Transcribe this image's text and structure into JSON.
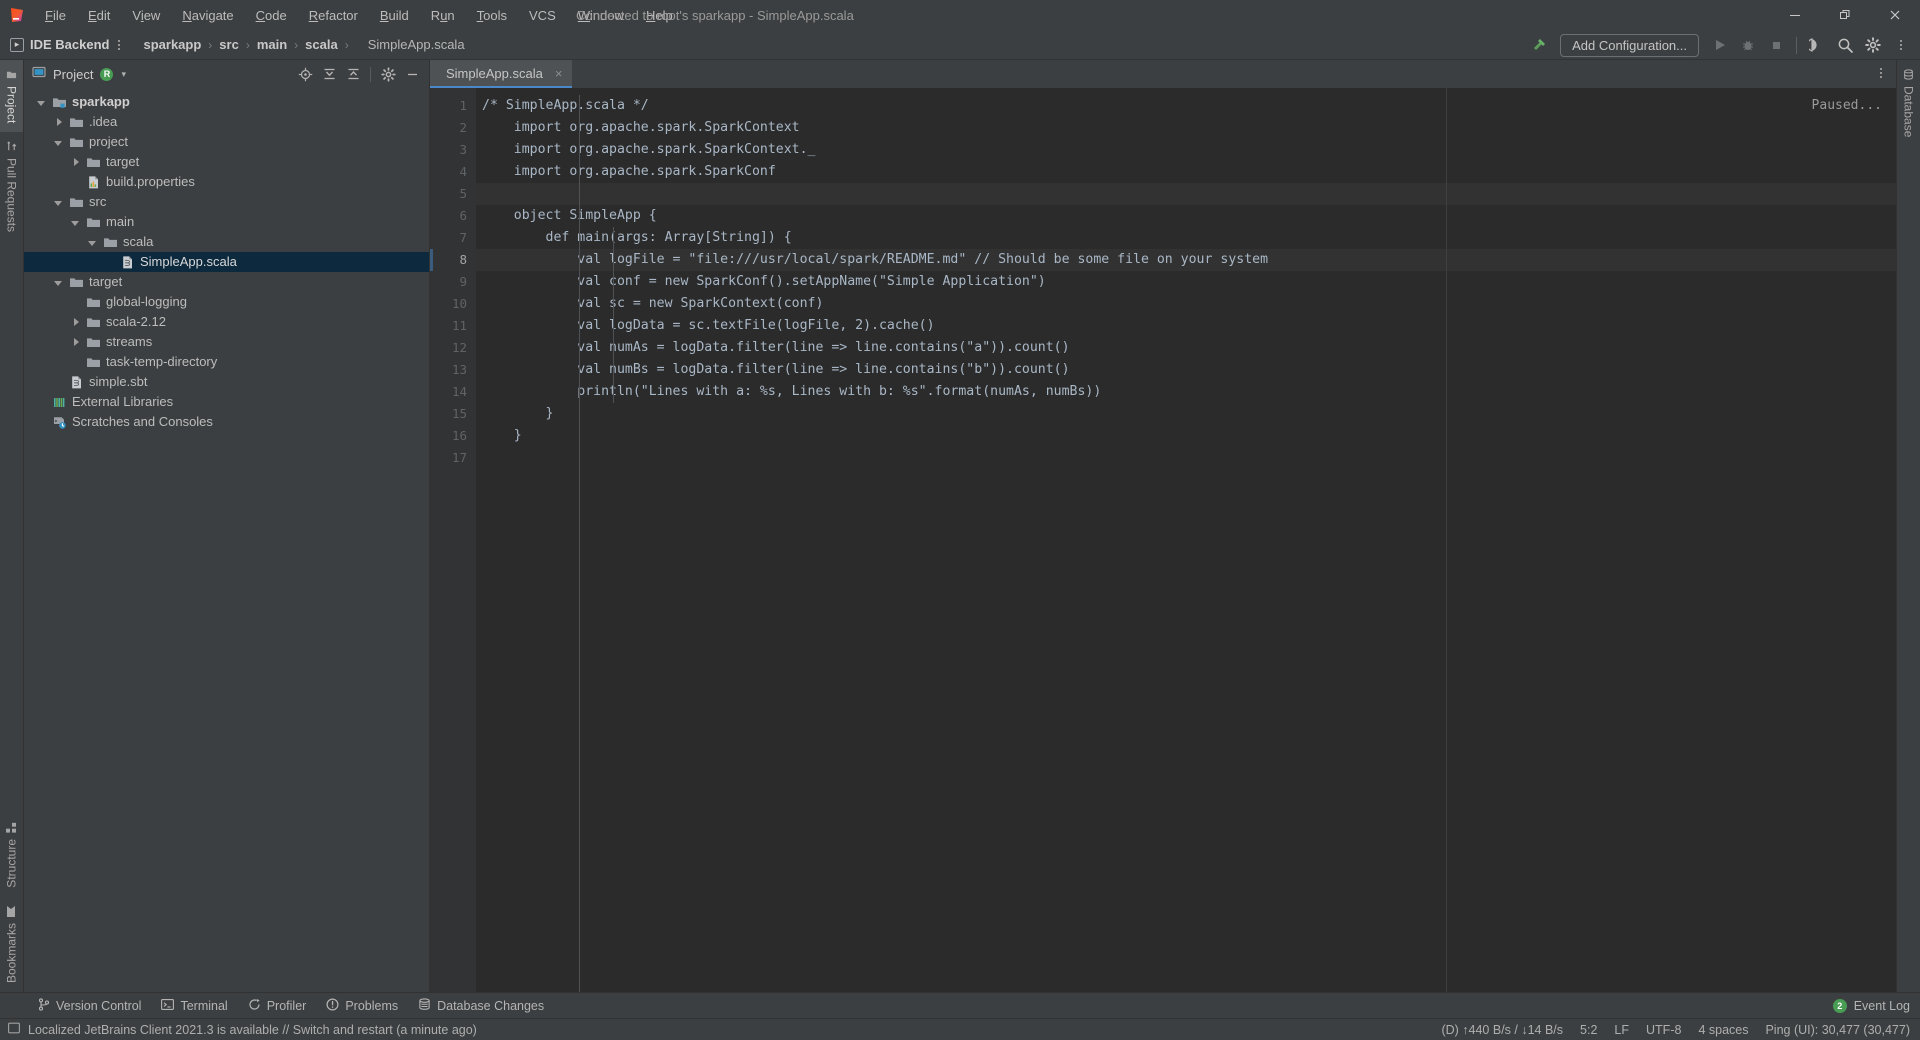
{
  "window": {
    "connection_title": "Connected to root's sparkapp - SimpleApp.scala",
    "minimize": "—",
    "maximize": "❐",
    "close": "×"
  },
  "menubar": {
    "items": [
      {
        "label": "File",
        "mnemonic": "F"
      },
      {
        "label": "Edit",
        "mnemonic": "E"
      },
      {
        "label": "View",
        "mnemonic": "V"
      },
      {
        "label": "Navigate",
        "mnemonic": "N"
      },
      {
        "label": "Code",
        "mnemonic": "C"
      },
      {
        "label": "Refactor",
        "mnemonic": "R"
      },
      {
        "label": "Build",
        "mnemonic": "B"
      },
      {
        "label": "Run",
        "mnemonic": "u"
      },
      {
        "label": "Tools",
        "mnemonic": "T"
      },
      {
        "label": "VCS",
        "mnemonic": ""
      },
      {
        "label": "Window",
        "mnemonic": "W"
      },
      {
        "label": "Help",
        "mnemonic": "H"
      }
    ]
  },
  "navbar": {
    "backend_label": "IDE Backend",
    "breadcrumbs": [
      "sparkapp",
      "src",
      "main",
      "scala"
    ],
    "current_file": "SimpleApp.scala",
    "separator": "›",
    "add_configuration": "Add Configuration...",
    "icons": [
      "build-hammer-icon",
      "run-icon",
      "debug-icon",
      "stop-icon",
      "run-with-coverage-icon",
      "search-icon",
      "settings-gear-icon",
      "more-vertical-icon"
    ]
  },
  "left_rail": {
    "top": [
      {
        "label": "Project",
        "icon": "project-folder-icon",
        "active": true
      },
      {
        "label": "Pull Requests",
        "icon": "pull-request-icon",
        "active": false
      }
    ],
    "bottom": [
      {
        "label": "Structure",
        "icon": "structure-icon",
        "active": false
      },
      {
        "label": "Bookmarks",
        "icon": "bookmark-icon",
        "active": false
      }
    ]
  },
  "right_rail": {
    "items": [
      {
        "label": "Database",
        "icon": "database-icon"
      }
    ]
  },
  "project_panel": {
    "title": "Project",
    "badge": "R",
    "caret": "▾",
    "actions": [
      "locate-target-icon",
      "expand-all-icon",
      "collapse-all-icon",
      "settings-gear-icon",
      "hide-icon"
    ],
    "tree": [
      {
        "label": "sparkapp",
        "depth": 0,
        "arrow": "down",
        "icon": "module-folder-icon",
        "bold": true,
        "selected": false
      },
      {
        "label": ".idea",
        "depth": 1,
        "arrow": "right",
        "icon": "folder-icon",
        "bold": false,
        "selected": false
      },
      {
        "label": "project",
        "depth": 1,
        "arrow": "down",
        "icon": "folder-icon",
        "bold": false,
        "selected": false
      },
      {
        "label": "target",
        "depth": 2,
        "arrow": "right",
        "icon": "folder-icon",
        "bold": false,
        "selected": false
      },
      {
        "label": "build.properties",
        "depth": 2,
        "arrow": "none",
        "icon": "properties-file-icon",
        "bold": false,
        "selected": false
      },
      {
        "label": "src",
        "depth": 1,
        "arrow": "down",
        "icon": "folder-icon",
        "bold": false,
        "selected": false
      },
      {
        "label": "main",
        "depth": 2,
        "arrow": "down",
        "icon": "folder-icon",
        "bold": false,
        "selected": false
      },
      {
        "label": "scala",
        "depth": 3,
        "arrow": "down",
        "icon": "folder-icon",
        "bold": false,
        "selected": false
      },
      {
        "label": "SimpleApp.scala",
        "depth": 4,
        "arrow": "none",
        "icon": "scala-file-icon",
        "bold": false,
        "selected": true
      },
      {
        "label": "target",
        "depth": 1,
        "arrow": "down",
        "icon": "folder-icon",
        "bold": false,
        "selected": false
      },
      {
        "label": "global-logging",
        "depth": 2,
        "arrow": "none",
        "icon": "folder-icon",
        "bold": false,
        "selected": false
      },
      {
        "label": "scala-2.12",
        "depth": 2,
        "arrow": "right",
        "icon": "folder-icon",
        "bold": false,
        "selected": false
      },
      {
        "label": "streams",
        "depth": 2,
        "arrow": "right",
        "icon": "folder-icon",
        "bold": false,
        "selected": false
      },
      {
        "label": "task-temp-directory",
        "depth": 2,
        "arrow": "none",
        "icon": "folder-icon",
        "bold": false,
        "selected": false
      },
      {
        "label": "simple.sbt",
        "depth": 1,
        "arrow": "none",
        "icon": "sbt-file-icon",
        "bold": false,
        "selected": false
      },
      {
        "label": "External Libraries",
        "depth": 0,
        "arrow": "none",
        "icon": "libraries-icon",
        "bold": false,
        "selected": false
      },
      {
        "label": "Scratches and Consoles",
        "depth": 0,
        "arrow": "none",
        "icon": "scratches-icon",
        "bold": false,
        "selected": false
      }
    ]
  },
  "editor": {
    "tab_label": "SimpleApp.scala",
    "tab_close": "×",
    "status_overlay": "Paused...",
    "current_line": 8,
    "line_numbers": [
      1,
      2,
      3,
      4,
      5,
      6,
      7,
      8,
      9,
      10,
      11,
      12,
      13,
      14,
      15,
      16,
      17
    ],
    "lines": [
      "/* SimpleApp.scala */",
      "    import org.apache.spark.SparkContext",
      "    import org.apache.spark.SparkContext._",
      "    import org.apache.spark.SparkConf",
      "",
      "    object SimpleApp {",
      "        def main(args: Array[String]) {",
      "            val logFile = \"file:///usr/local/spark/README.md\" // Should be some file on your system",
      "            val conf = new SparkConf().setAppName(\"Simple Application\")",
      "            val sc = new SparkContext(conf)",
      "            val logData = sc.textFile(logFile, 2).cache()",
      "            val numAs = logData.filter(line => line.contains(\"a\")).count()",
      "            val numBs = logData.filter(line => line.contains(\"b\")).count()",
      "            println(\"Lines with a: %s, Lines with b: %s\".format(numAs, numBs))",
      "        }",
      "    }",
      ""
    ]
  },
  "tool_windows": {
    "items": [
      {
        "label": "Version Control",
        "icon": "branch-icon"
      },
      {
        "label": "Terminal",
        "icon": "terminal-icon"
      },
      {
        "label": "Profiler",
        "icon": "profiler-icon"
      },
      {
        "label": "Problems",
        "icon": "problems-icon"
      },
      {
        "label": "Database Changes",
        "icon": "database-changes-icon"
      }
    ],
    "event_log": {
      "label": "Event Log",
      "count": "2"
    }
  },
  "statusbar": {
    "message": "Localized JetBrains Client 2021.3 is available // Switch and restart (a minute ago)",
    "right": [
      "(D) ↑440 B/s / ↓14 B/s",
      "5:2",
      "LF",
      "UTF-8",
      "4 spaces",
      "Ping (UI): 30,477 (30,477)"
    ]
  },
  "colors": {
    "chrome": "#3c3f41",
    "editor_bg": "#2b2b2b",
    "gutter_bg": "#313335",
    "code_fg": "#a9b7c6",
    "selection": "#0d293e",
    "accent": "#4a88c7",
    "green": "#499c54"
  }
}
